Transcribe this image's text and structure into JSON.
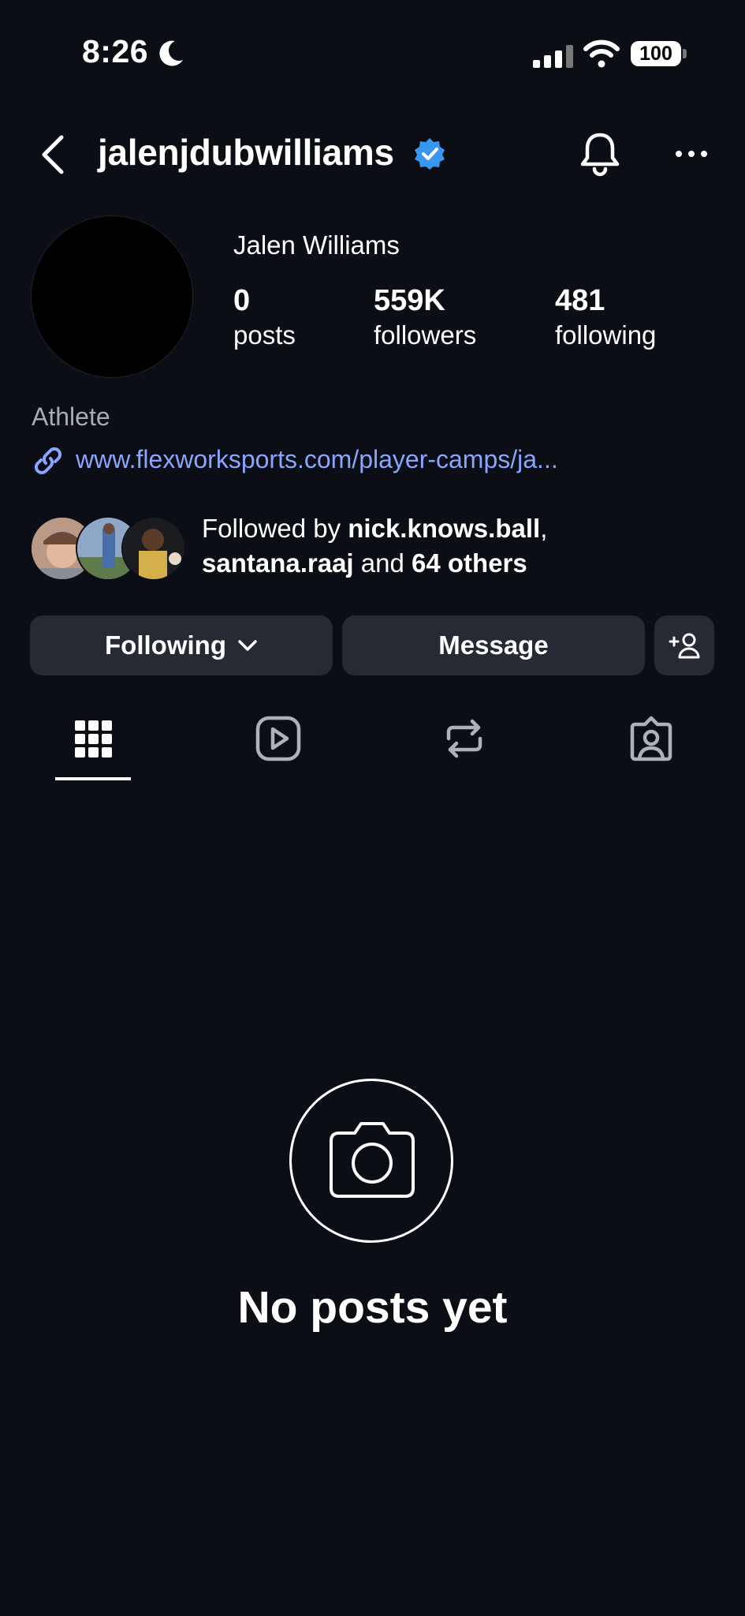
{
  "status_bar": {
    "time": "8:26",
    "battery": "100"
  },
  "header": {
    "username": "jalenjdubwilliams"
  },
  "profile": {
    "full_name": "Jalen Williams",
    "stats": [
      {
        "value": "0",
        "label": "posts"
      },
      {
        "value": "559K",
        "label": "followers"
      },
      {
        "value": "481",
        "label": "following"
      }
    ],
    "category": "Athlete",
    "link": "www.flexworksports.com/player-camps/ja..."
  },
  "followed_by": {
    "prefix": "Followed by ",
    "user1": "nick.knows.ball",
    "comma": ",",
    "user2": "santana.raaj",
    "middle": " and ",
    "others": "64 others"
  },
  "actions": {
    "following": "Following",
    "message": "Message"
  },
  "tabs": [
    "grid-icon",
    "reels-icon",
    "reposts-icon",
    "tagged-icon"
  ],
  "empty_state": {
    "text": "No posts yet"
  },
  "colors": {
    "background": "#0b0e15",
    "button": "#262a33",
    "link": "#8aa5ff",
    "verified": "#3897f0"
  }
}
